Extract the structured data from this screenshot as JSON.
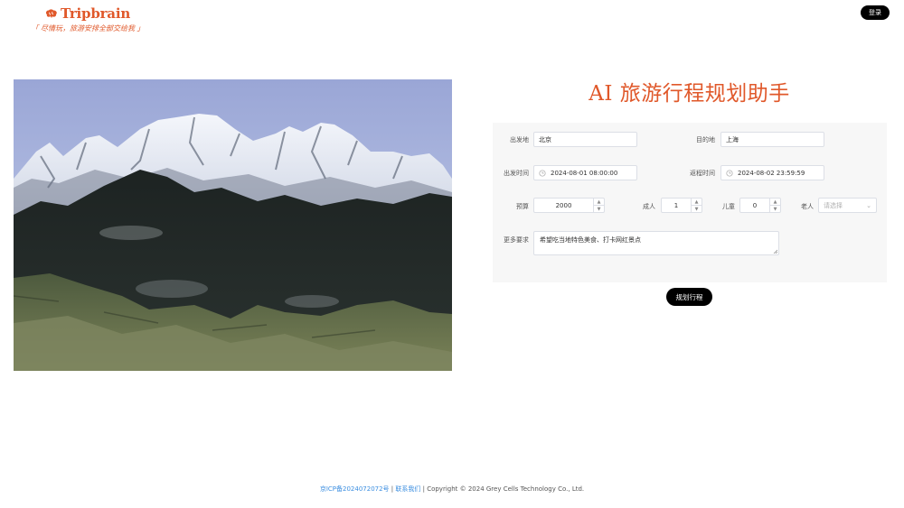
{
  "header": {
    "brand_name": "Tripbrain",
    "slogan": "「 尽情玩，旅游安排全部交给我 」",
    "login_label": "登录",
    "accent_color": "#e0582a"
  },
  "main": {
    "title": "AI 旅游行程规划助手",
    "form": {
      "origin_label": "出发地",
      "origin_value": "北京",
      "destination_label": "目的地",
      "destination_value": "上海",
      "depart_time_label": "出发时间",
      "depart_time_value": "2024-08-01 08:00:00",
      "return_time_label": "返程时间",
      "return_time_value": "2024-08-02 23:59:59",
      "budget_label": "预算",
      "budget_value": "2000",
      "adults_label": "成人",
      "adults_value": "1",
      "children_label": "儿童",
      "children_value": "0",
      "elderly_label": "老人",
      "elderly_placeholder": "请选择",
      "requirements_label": "更多要求",
      "requirements_value": "希望吃当地特色美食、打卡网红景点"
    },
    "plan_button_label": "规划行程"
  },
  "footer": {
    "icp": "京ICP备2024072072号",
    "separator1": " | ",
    "contact": "联系我们",
    "separator2": " | ",
    "copyright": "Copyright © 2024 Grey Cells Technology Co., Ltd."
  },
  "icons": {
    "brand": "brain-icon",
    "time": "clock-icon",
    "increment": "chevron-up-icon",
    "decrement": "chevron-down-icon",
    "select": "chevron-down-icon"
  }
}
